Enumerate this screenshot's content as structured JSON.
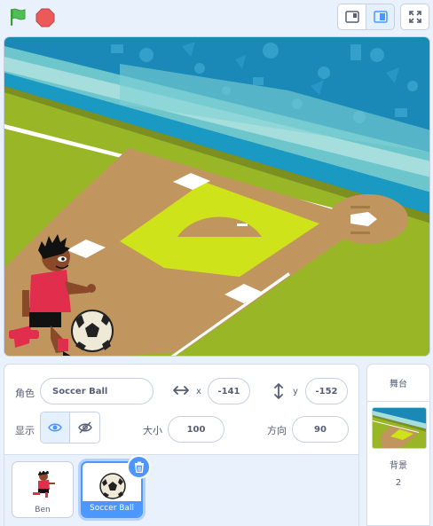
{
  "controls": {
    "green_flag": "green-flag-icon",
    "stop": "stop-icon",
    "small_stage": "small-stage-icon",
    "large_stage": "large-stage-icon",
    "fullscreen": "fullscreen-icon"
  },
  "sprite_info": {
    "sprite_label": "角色",
    "sprite_name": "Soccer Ball",
    "x_label": "x",
    "x_value": "-141",
    "y_label": "y",
    "y_value": "-152",
    "show_label": "显示",
    "size_label": "大小",
    "size_value": "100",
    "direction_label": "方向",
    "direction_value": "90"
  },
  "sprites": [
    {
      "name": "Ben",
      "selected": false
    },
    {
      "name": "Soccer Ball",
      "selected": true
    }
  ],
  "stage_pane": {
    "header": "舞台",
    "backdrops_label": "背景",
    "backdrops_count": "2"
  },
  "colors": {
    "accent": "#4c97ff",
    "flag": "#4cbf56",
    "stop": "#ec5959",
    "grass": "#99b627",
    "infield_grass": "#cfe31a",
    "dirt": "#c0955e"
  }
}
